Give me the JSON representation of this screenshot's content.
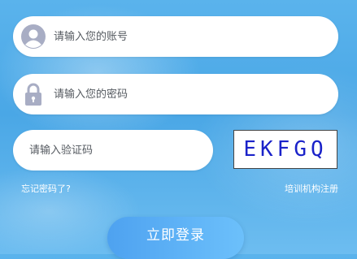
{
  "account": {
    "placeholder": "请输入您的账号",
    "icon": "user-avatar-icon"
  },
  "password": {
    "placeholder": "请输入您的密码",
    "icon": "lock-icon"
  },
  "captcha": {
    "placeholder": "请输入验证码",
    "code": "EKFGQ"
  },
  "links": {
    "forgot": "忘记密码了?",
    "register": "培训机构注册"
  },
  "login": {
    "label": "立即登录"
  },
  "colors": {
    "accent": "#4ea2f0",
    "captcha_text": "#1a22c9",
    "icon_gray": "#a8adc4"
  }
}
